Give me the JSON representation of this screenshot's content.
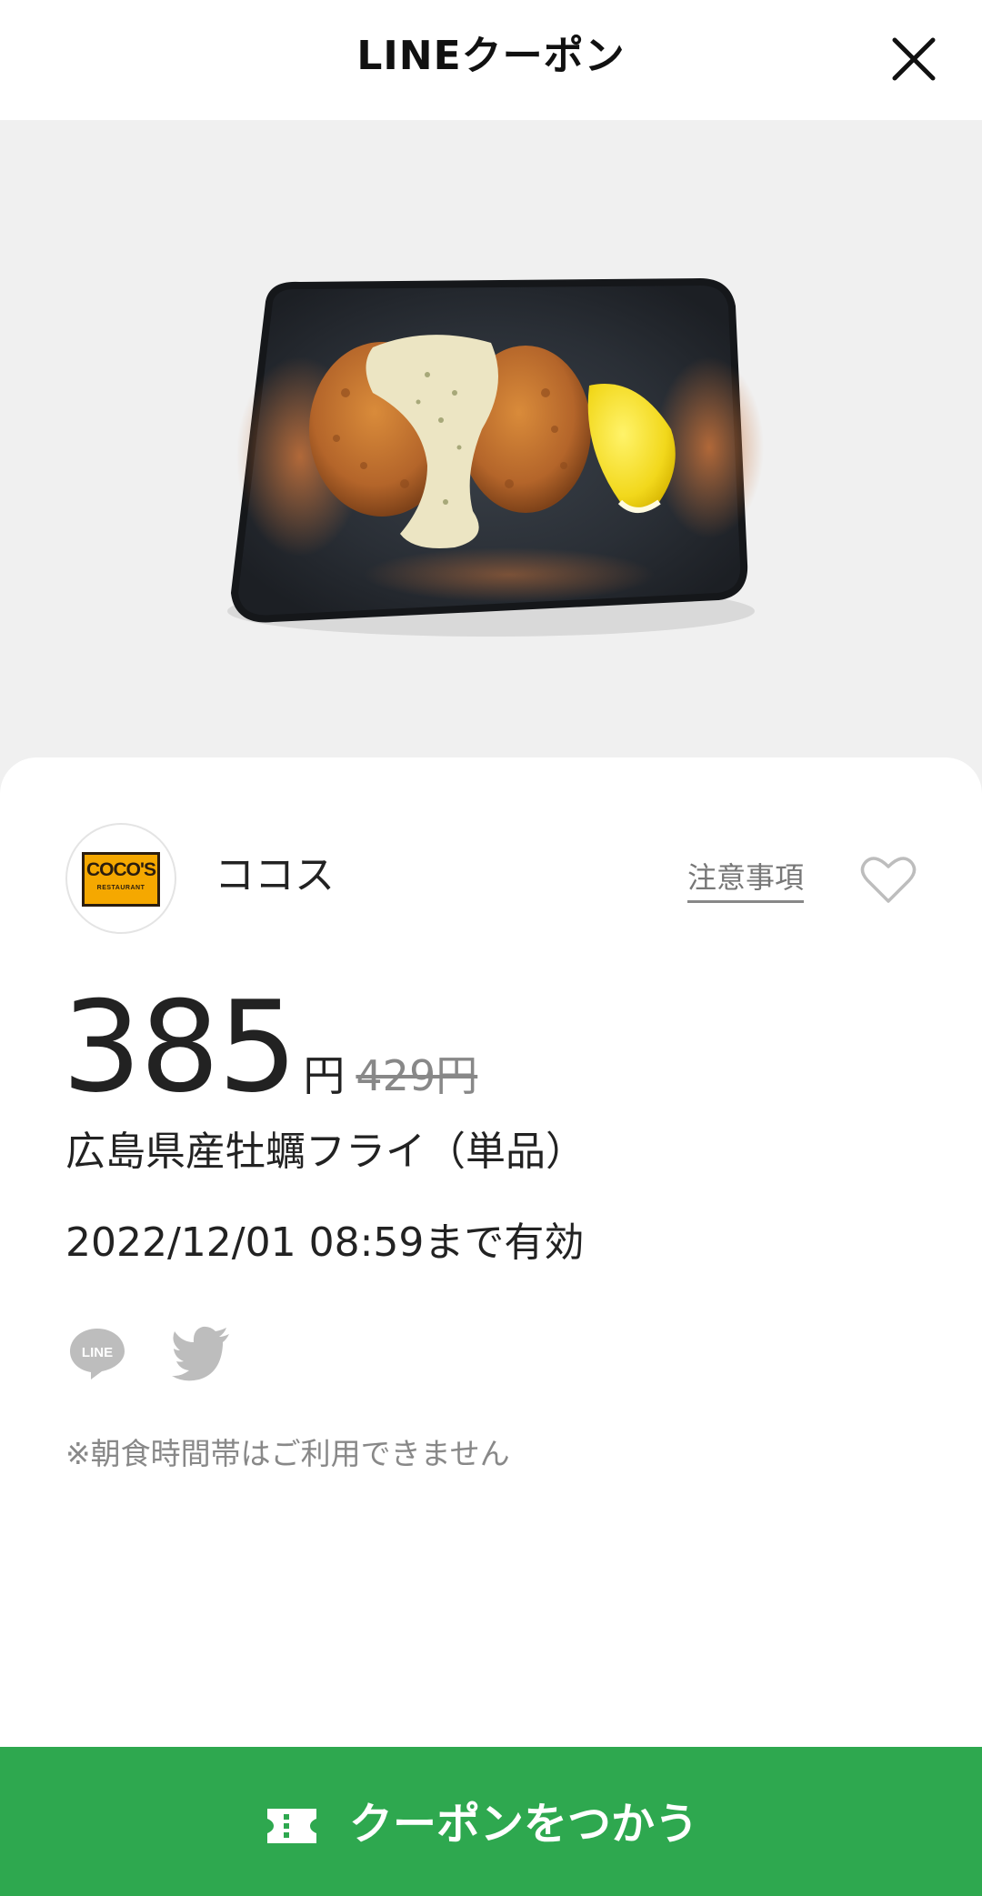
{
  "header": {
    "title": "LINEクーポン",
    "close_icon": "close-icon"
  },
  "hero": {
    "image_description_icon": "food-photo"
  },
  "store": {
    "logo_text": "COCO'S",
    "logo_subtext": "RESTAURANT",
    "name": "ココス",
    "notice_label": "注意事項",
    "favorite_icon": "heart-icon"
  },
  "coupon": {
    "price": "385",
    "currency": "円",
    "original_price": "429円",
    "product_name": "広島県産牡蠣フライ（単品）",
    "validity": "2022/12/01 08:59まで有効",
    "note": "※朝食時間帯はご利用できません"
  },
  "share": {
    "line_label": "LINE",
    "twitter_icon": "twitter-icon"
  },
  "cta": {
    "label": "クーポンをつかう",
    "icon": "ticket-icon"
  },
  "colors": {
    "brand_green": "#2ea84f",
    "hero_bg": "#f0f0f0",
    "logo_orange": "#f5a800"
  }
}
